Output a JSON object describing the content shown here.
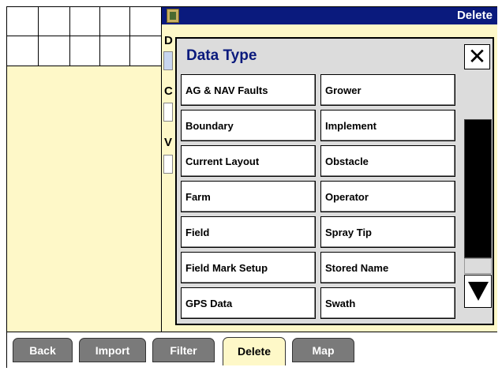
{
  "header": {
    "title": "Delete",
    "flag_icon": "field-flag-icon"
  },
  "background_form": {
    "labels": [
      "D",
      "C",
      "V"
    ]
  },
  "dialog": {
    "title": "Data Type",
    "close_label": "✕",
    "options_left": [
      "AG & NAV Faults",
      "Boundary",
      "Current Layout",
      "Farm",
      "Field",
      "Field Mark Setup",
      "GPS Data"
    ],
    "options_right": [
      "Grower",
      "Implement",
      "Obstacle",
      "Operator",
      "Spray Tip",
      "Stored Name",
      "Swath"
    ]
  },
  "tabs": [
    {
      "label": "Back",
      "active": false
    },
    {
      "label": "Import",
      "active": false
    },
    {
      "label": "Filter",
      "active": false
    },
    {
      "label": "Delete",
      "active": true
    },
    {
      "label": "Map",
      "active": false
    }
  ],
  "colors": {
    "header": "#0a1a7d",
    "panel": "#fef8c8",
    "tab": "#7a7a7a"
  }
}
